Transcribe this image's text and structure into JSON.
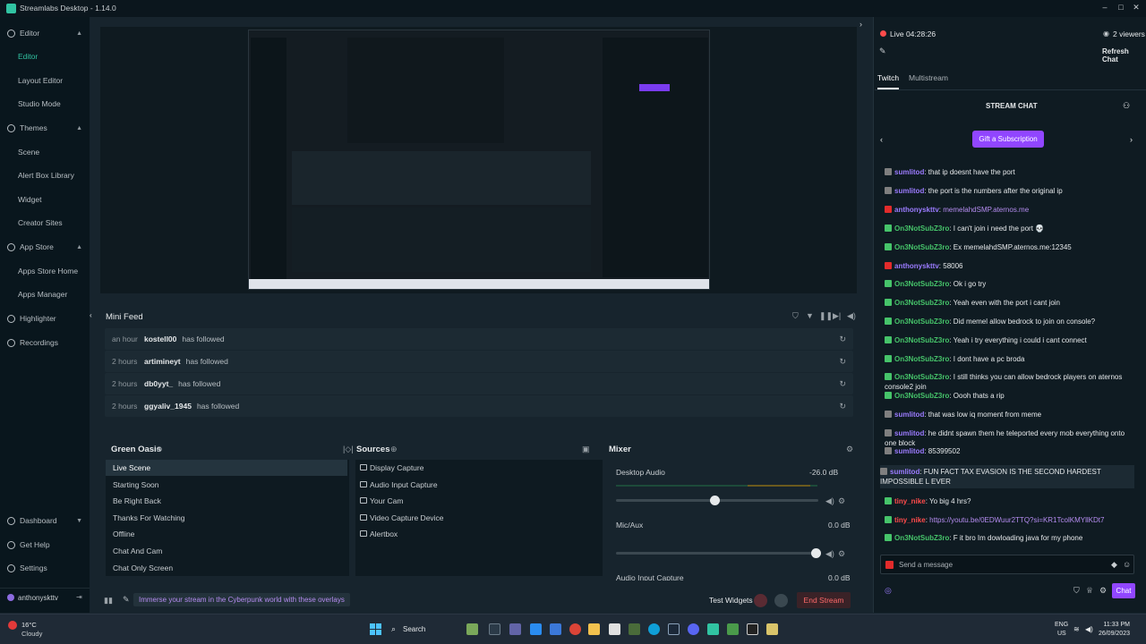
{
  "window": {
    "title": "Streamlabs Desktop - 1.14.0"
  },
  "sidebar": {
    "items": [
      {
        "label": "Editor",
        "type": "section"
      },
      {
        "label": "Editor",
        "type": "sub",
        "active": true
      },
      {
        "label": "Layout Editor",
        "type": "sub"
      },
      {
        "label": "Studio Mode",
        "type": "sub"
      },
      {
        "label": "Themes",
        "type": "section"
      },
      {
        "label": "Scene",
        "type": "sub"
      },
      {
        "label": "Alert Box Library",
        "type": "sub"
      },
      {
        "label": "Widget",
        "type": "sub"
      },
      {
        "label": "Creator Sites",
        "type": "sub"
      },
      {
        "label": "App Store",
        "type": "section"
      },
      {
        "label": "Apps Store Home",
        "type": "sub"
      },
      {
        "label": "Apps Manager",
        "type": "sub"
      },
      {
        "label": "Highlighter",
        "type": "item"
      },
      {
        "label": "Recordings",
        "type": "item"
      }
    ],
    "bottom": [
      {
        "label": "Dashboard"
      },
      {
        "label": "Get Help"
      },
      {
        "label": "Settings"
      }
    ],
    "username": "anthonyskttv"
  },
  "minifeed": {
    "title": "Mini Feed",
    "rows": [
      {
        "time": "an hour",
        "user": "kostell00",
        "action": "has followed"
      },
      {
        "time": "2 hours",
        "user": "artimineyt",
        "action": "has followed"
      },
      {
        "time": "2 hours",
        "user": "db0yyt_",
        "action": "has followed"
      },
      {
        "time": "2 hours",
        "user": "ggyaliv_1945",
        "action": "has followed"
      }
    ]
  },
  "scenes": {
    "title": "Green Oasis",
    "items": [
      "Live Scene",
      "Starting Soon",
      "Be Right Back",
      "Thanks For Watching",
      "Offline",
      "Chat And Cam",
      "Chat Only Screen"
    ],
    "active_index": 0
  },
  "sources": {
    "title": "Sources",
    "items": [
      "Display Capture",
      "Audio Input Capture",
      "Your Cam",
      "Video Capture Device",
      "Alertbox"
    ]
  },
  "mixer": {
    "title": "Mixer",
    "channels": [
      {
        "name": "Desktop Audio",
        "value": "-26.0 dB",
        "level": 0.49
      },
      {
        "name": "Mic/Aux",
        "value": "0.0 dB",
        "level": 0.99
      },
      {
        "name": "Audio Input Capture",
        "value": "0.0 dB"
      }
    ]
  },
  "footer": {
    "promo": "Immerse your stream in the Cyberpunk world with these overlays",
    "test_widgets": "Test Widgets",
    "end_stream": "End Stream"
  },
  "chat": {
    "live_time": "Live 04:28:26",
    "viewers": "2 viewers",
    "refresh": "Refresh Chat",
    "tabs": [
      "Twitch",
      "Multistream"
    ],
    "title": "STREAM CHAT",
    "gift_button": "Gift a Subscription",
    "messages": [
      {
        "user": "sumlitod",
        "text": "that ip doesnt have the port",
        "color": "#9b7bff",
        "badge": "#7f7f7f"
      },
      {
        "user": "sumlitod",
        "text": "the port is the numbers after the original ip",
        "color": "#9b7bff",
        "badge": "#7f7f7f"
      },
      {
        "user": "anthonyskttv",
        "text": "memelahdSMP.aternos.me",
        "color": "#9b7bff",
        "badge": "#e22b2b",
        "link": true
      },
      {
        "user": "On3NotSubZ3ro",
        "text": "I can't join i need the port 💀",
        "color": "#46c46a",
        "badge": "#46c46a"
      },
      {
        "user": "On3NotSubZ3ro",
        "text": "Ex memelahdSMP.aternos.me:12345",
        "color": "#46c46a",
        "badge": "#46c46a"
      },
      {
        "user": "anthonyskttv",
        "text": "58006",
        "color": "#9b7bff",
        "badge": "#e22b2b"
      },
      {
        "user": "On3NotSubZ3ro",
        "text": "Ok i go try",
        "color": "#46c46a",
        "badge": "#46c46a"
      },
      {
        "user": "On3NotSubZ3ro",
        "text": "Yeah even with the port i cant join",
        "color": "#46c46a",
        "badge": "#46c46a"
      },
      {
        "user": "On3NotSubZ3ro",
        "text": "Did memel allow bedrock to join on console?",
        "color": "#46c46a",
        "badge": "#46c46a"
      },
      {
        "user": "On3NotSubZ3ro",
        "text": "Yeah i try everything i could i cant connect",
        "color": "#46c46a",
        "badge": "#46c46a"
      },
      {
        "user": "On3NotSubZ3ro",
        "text": "I dont have a pc broda",
        "color": "#46c46a",
        "badge": "#46c46a"
      },
      {
        "user": "On3NotSubZ3ro",
        "text": "I still thinks you can allow bedrock players on aternos console2 join",
        "color": "#46c46a",
        "badge": "#46c46a"
      },
      {
        "user": "On3NotSubZ3ro",
        "text": "Oooh thats a rip",
        "color": "#46c46a",
        "badge": "#46c46a"
      },
      {
        "user": "sumlitod",
        "text": "that was low iq moment from meme",
        "color": "#9b7bff",
        "badge": "#7f7f7f"
      },
      {
        "user": "sumlitod",
        "text": "he didnt spawn them he teleported every mob everything onto one block",
        "color": "#9b7bff",
        "badge": "#7f7f7f"
      },
      {
        "user": "sumlitod",
        "text": "85399502",
        "color": "#9b7bff",
        "badge": "#7f7f7f"
      },
      {
        "user": "sumlitod",
        "text": "FUN FACT TAX EVASION IS THE SECOND HARDEST IMPOSSIBLE L EVER",
        "color": "#9b7bff",
        "badge": "#7f7f7f",
        "highlight": true
      },
      {
        "user": "tiny_nike",
        "text": "Yo big 4 hrs?",
        "color": "#ff4b4b",
        "badge": "#46c46a"
      },
      {
        "user": "tiny_nike",
        "text": "https://youtu.be/0EDWuur2TTQ?si=KR1TcolKMYllKDt7",
        "color": "#ff4b4b",
        "badge": "#46c46a",
        "link": true
      },
      {
        "user": "On3NotSubZ3ro",
        "text": "F it bro Im dowloading java for my phone",
        "color": "#46c46a",
        "badge": "#46c46a"
      }
    ],
    "input_placeholder": "Send a message",
    "send_label": "Chat"
  },
  "taskbar": {
    "weather_temp": "16°C",
    "weather_desc": "Cloudy",
    "search": "Search",
    "lang1": "ENG",
    "lang2": "US",
    "time": "11:33 PM",
    "date": "26/09/2023"
  },
  "colors": {
    "accent": "#31c3a2",
    "twitch": "#9146ff",
    "end_stream": "#ff6a6a"
  }
}
